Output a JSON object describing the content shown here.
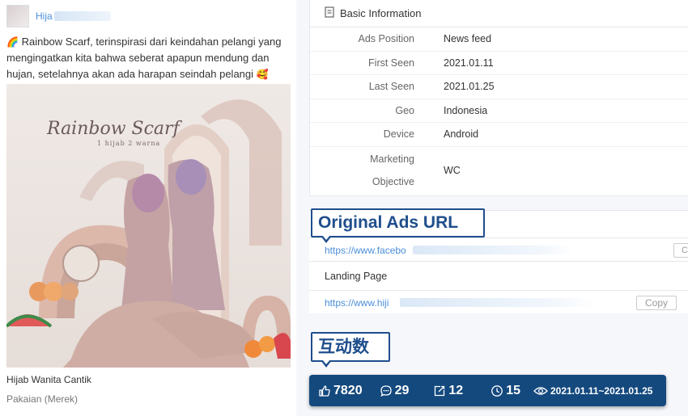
{
  "ad": {
    "author_name": "Hija",
    "text_line1": "Rainbow Scarf, terinspirasi dari keindahan pelangi yang",
    "text_line2": "mengingatkan kita bahwa seberat apapun mendung dan",
    "text_line3": "hujan, setelahnya akan ada harapan seindah pelangi",
    "emoji_start": "🌈",
    "emoji_end": "🥰",
    "image_title": "Rainbow Scarf",
    "image_subtitle": "1 hijab 2 warna",
    "caption_title": "Hijab Wanita Cantik",
    "caption_sub": "Pakaian (Merek)"
  },
  "basic_info": {
    "heading": "Basic Information",
    "rows": [
      {
        "label": "Ads Position",
        "value": "News feed"
      },
      {
        "label": "First Seen",
        "value": "2021.01.11"
      },
      {
        "label": "Last Seen",
        "value": "2021.01.25"
      },
      {
        "label": "Geo",
        "value": "Indonesia"
      },
      {
        "label": "Device",
        "value": "Android"
      },
      {
        "label_line1": "Marketing",
        "label_line2": "Objective",
        "value": "WC"
      }
    ]
  },
  "urls": {
    "original_url": "https://www.facebo",
    "copy_label_cut": "C",
    "landing_label": "Landing Page",
    "landing_url": "https://www.hiji",
    "copy_label": "Copy"
  },
  "callouts": {
    "original_ads_url": "Original Ads URL",
    "interactions": "互动数"
  },
  "stats": {
    "likes": "7820",
    "comments": "29",
    "shares": "12",
    "days": "15",
    "date_range": "2021.01.11~2021.01.25"
  },
  "colors": {
    "accent_blue": "#4a8fd8",
    "callout_navy": "#1f4e8c",
    "stats_bg": "#14497e"
  }
}
